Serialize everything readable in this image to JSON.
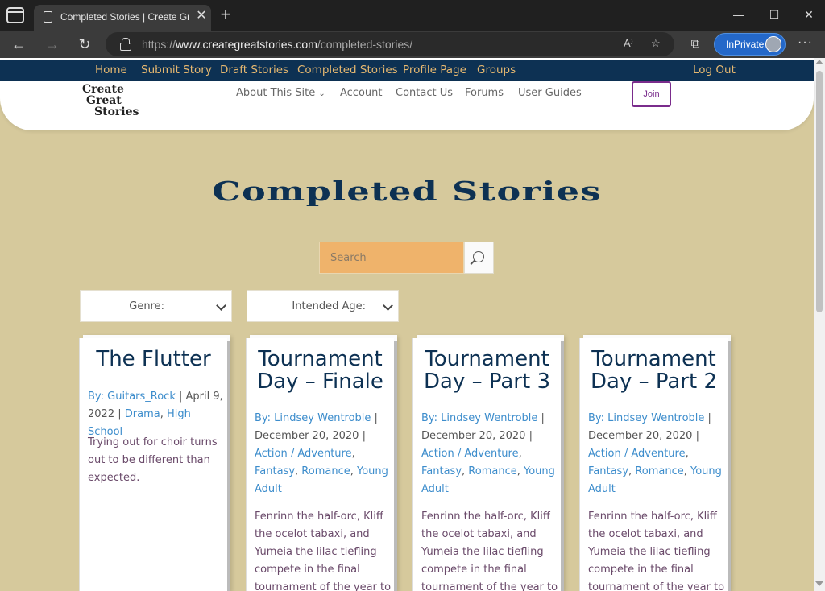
{
  "browser": {
    "tab_title": "Completed Stories | Create Great",
    "url_prefix": "https://",
    "url_domain": "www.creategreatstories.com",
    "url_path": "/completed-stories/",
    "inprivate_label": "InPrivate",
    "accent": "#2468c9"
  },
  "top_nav": {
    "items": [
      "Home",
      "Submit Story",
      "Draft Stories",
      "Completed Stories",
      "Profile Page",
      "Groups"
    ],
    "logout": "Log Out",
    "bg": "#0d3153",
    "link_color": "#e6b870"
  },
  "header": {
    "logo_lines": [
      "Create",
      "Great",
      "Stories"
    ],
    "sub_nav": [
      "About This Site",
      "Account",
      "Contact Us",
      "Forums",
      "User Guides"
    ],
    "join": "Join"
  },
  "page": {
    "title": "Completed Stories",
    "search_placeholder": "Search",
    "filters": [
      "Genre:",
      "Intended Age:"
    ]
  },
  "cards": [
    {
      "title": "The Flutter",
      "author": "By: Guitars_Rock",
      "date": "April 9, 2022",
      "genres": [
        "Drama"
      ],
      "age": "High School",
      "excerpt": "Trying out for choir turns out to be different than expected."
    },
    {
      "title": "Tournament Day – Finale",
      "author": "By: Lindsey Wentroble",
      "date": "December 20, 2020",
      "genres": [
        "Action / Adventure",
        "Fantasy",
        "Romance"
      ],
      "age": "Young Adult",
      "excerpt": "Fenrinn the half-orc, Kliff the ocelot tabaxi, and Yumeia the lilac tiefling compete in the final tournament of the year to"
    },
    {
      "title": "Tournament Day – Part 3",
      "author": "By: Lindsey Wentroble",
      "date": "December 20, 2020",
      "genres": [
        "Action / Adventure",
        "Fantasy",
        "Romance"
      ],
      "age": "Young Adult",
      "excerpt": "Fenrinn the half-orc, Kliff the ocelot tabaxi, and Yumeia the lilac tiefling compete in the final tournament of the year to"
    },
    {
      "title": "Tournament Day – Part 2",
      "author": "By: Lindsey Wentroble",
      "date": "December 20, 2020",
      "genres": [
        "Action / Adventure",
        "Fantasy",
        "Romance"
      ],
      "age": "Young Adult",
      "excerpt": "Fenrinn the half-orc, Kliff the ocelot tabaxi, and Yumeia the lilac tiefling compete in the final tournament of the year to"
    }
  ]
}
